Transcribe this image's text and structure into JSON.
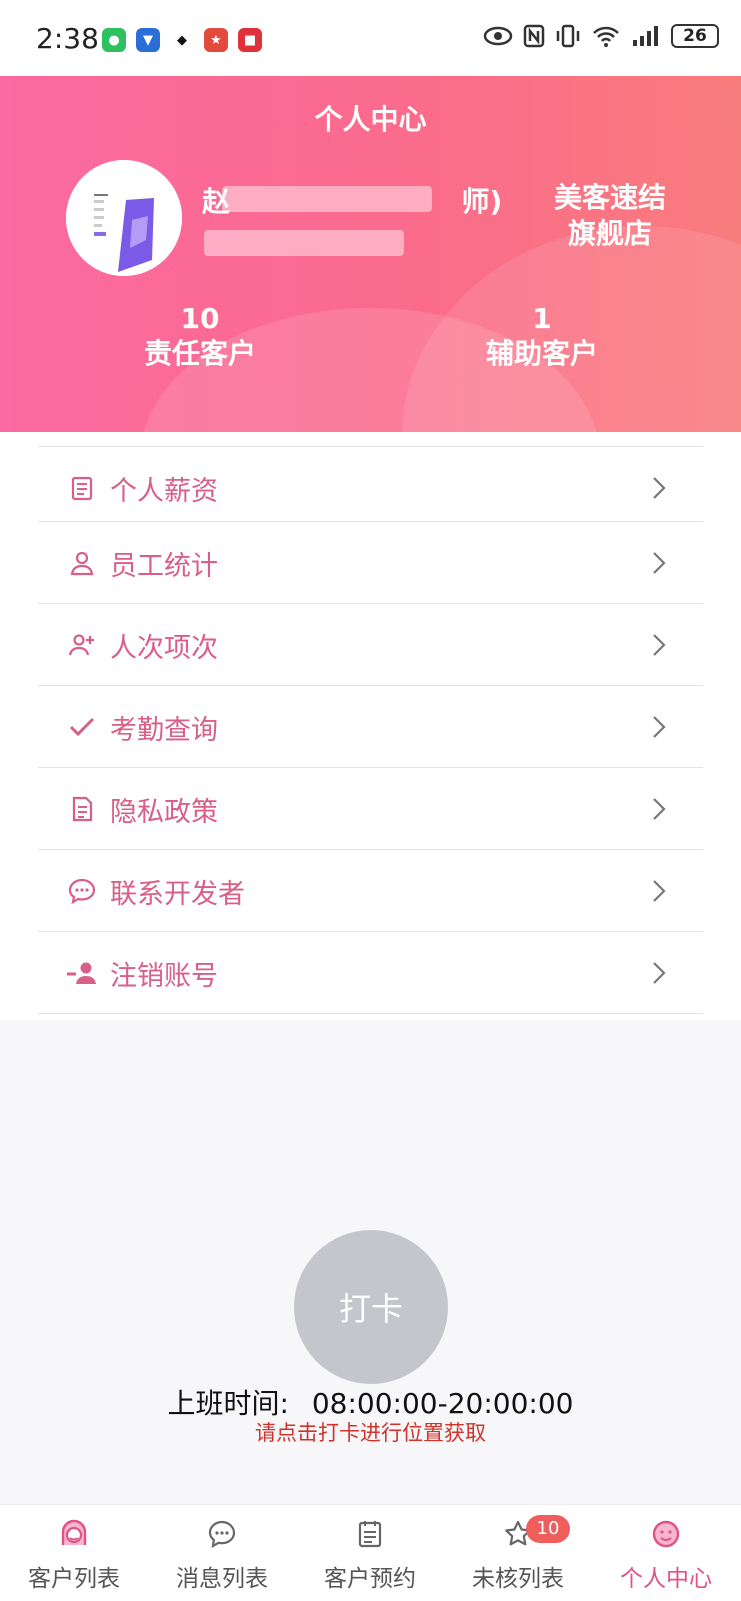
{
  "status_bar": {
    "time": "2:38",
    "battery": "26"
  },
  "header": {
    "title": "个人中心",
    "user_name_visible_start": "赵",
    "user_name_visible_end": "师)",
    "store_name_line1": "美客速结",
    "store_name_line2": "旗舰店",
    "stats": [
      {
        "value": "10",
        "label": "责任客户"
      },
      {
        "value": "1",
        "label": "辅助客户"
      }
    ]
  },
  "menu": {
    "items": [
      {
        "label": "个人薪资",
        "icon": "clipboard-icon"
      },
      {
        "label": "员工统计",
        "icon": "person-icon"
      },
      {
        "label": "人次项次",
        "icon": "person-add-icon"
      },
      {
        "label": "考勤查询",
        "icon": "check-icon"
      },
      {
        "label": "隐私政策",
        "icon": "document-icon"
      },
      {
        "label": "联系开发者",
        "icon": "chat-icon"
      },
      {
        "label": "注销账号",
        "icon": "person-remove-icon"
      }
    ]
  },
  "punch": {
    "button_label": "打卡",
    "work_time_label": "上班时间:",
    "work_time_value": "08:00:00-20:00:00",
    "hint": "请点击打卡进行位置获取"
  },
  "tabbar": {
    "tabs": [
      {
        "label": "客户列表",
        "icon": "customer-face-icon"
      },
      {
        "label": "消息列表",
        "icon": "message-icon"
      },
      {
        "label": "客户预约",
        "icon": "calendar-list-icon"
      },
      {
        "label": "未核列表",
        "icon": "star-icon",
        "badge": "10"
      },
      {
        "label": "个人中心",
        "icon": "profile-face-icon"
      }
    ],
    "active_index": 4
  },
  "colors": {
    "accent": "#e05389",
    "header_start": "#fb6aa0",
    "header_end": "#f97c7c",
    "menu_text": "#d95f86",
    "hint": "#d0332c"
  }
}
